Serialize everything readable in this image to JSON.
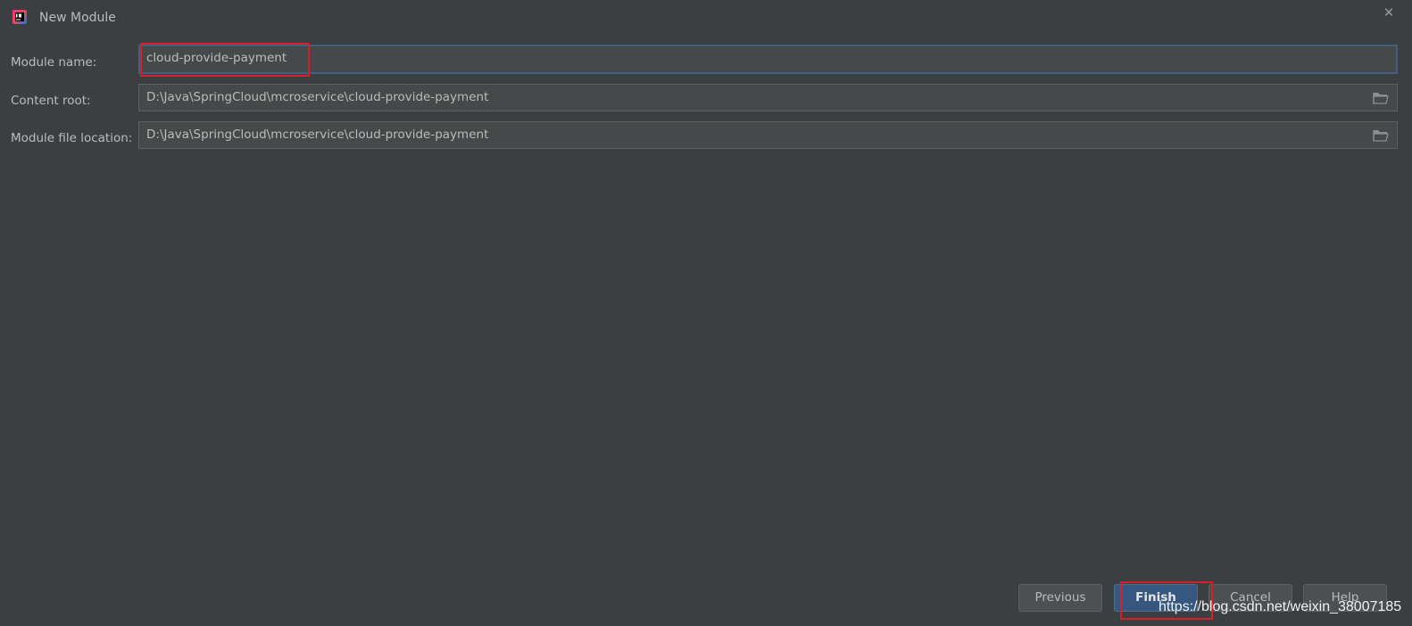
{
  "window": {
    "title": "New Module",
    "close_glyph": "✕"
  },
  "form": {
    "module_name": {
      "label": "Module name:",
      "value": "cloud-provide-payment"
    },
    "content_root": {
      "label": "Content root:",
      "value": "D:\\Java\\SpringCloud\\mcroservice\\cloud-provide-payment"
    },
    "module_file_location": {
      "label": "Module file location:",
      "value": "D:\\Java\\SpringCloud\\mcroservice\\cloud-provide-payment"
    }
  },
  "buttons": {
    "previous": "Previous",
    "finish": "Finish",
    "cancel": "Cancel",
    "help": "Help"
  },
  "watermark": "https://blog.csdn.net/weixin_38007185",
  "icons": {
    "app": "intellij-idea-icon",
    "browse": "folder-icon",
    "close": "close-icon"
  },
  "colors": {
    "background": "#3c3f41",
    "field_background": "#45494a",
    "focus_border": "#3d6185",
    "primary_button": "#365880",
    "annotation_red": "#d61f26"
  }
}
